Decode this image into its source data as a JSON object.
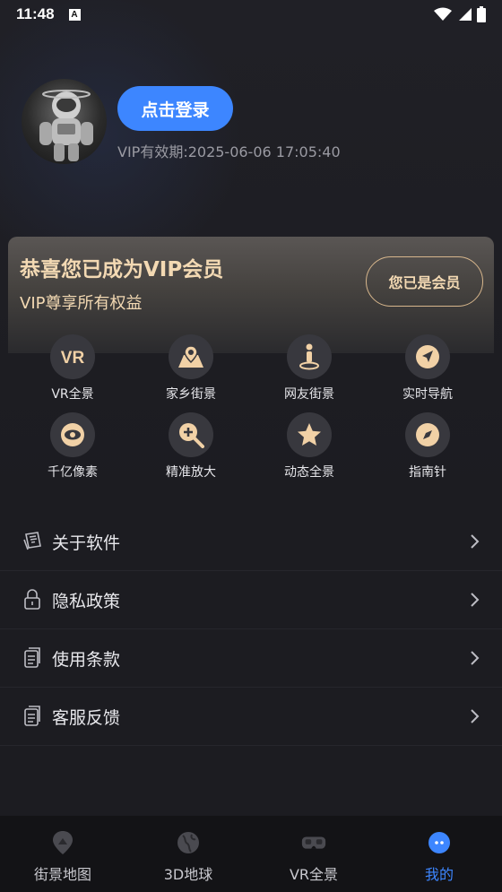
{
  "status_bar": {
    "time": "11:48",
    "notification_glyph": "A"
  },
  "profile": {
    "login_label": "点击登录",
    "vip_expiry": "VIP有效期:2025-06-06 17:05:40"
  },
  "vip_card": {
    "title": "恭喜您已成为VIP会员",
    "subtitle": "VIP尊享所有权益",
    "member_button": "您已是会员"
  },
  "features": [
    {
      "label": "VR全景",
      "icon": "vr-icon"
    },
    {
      "label": "家乡街景",
      "icon": "map-pin-icon"
    },
    {
      "label": "网友街景",
      "icon": "person-pin-icon"
    },
    {
      "label": "实时导航",
      "icon": "navigation-icon"
    },
    {
      "label": "千亿像素",
      "icon": "eye-icon"
    },
    {
      "label": "精准放大",
      "icon": "zoom-in-icon"
    },
    {
      "label": "动态全景",
      "icon": "star-icon"
    },
    {
      "label": "指南针",
      "icon": "compass-icon"
    }
  ],
  "menu": [
    {
      "label": "关于软件",
      "icon": "info-document-icon"
    },
    {
      "label": "隐私政策",
      "icon": "lock-icon"
    },
    {
      "label": "使用条款",
      "icon": "document-icon"
    },
    {
      "label": "客服反馈",
      "icon": "document-icon"
    }
  ],
  "bottom_nav": [
    {
      "label": "街景地图",
      "icon": "street-map-icon",
      "active": false
    },
    {
      "label": "3D地球",
      "icon": "globe-icon",
      "active": false
    },
    {
      "label": "VR全景",
      "icon": "vr-headset-icon",
      "active": false
    },
    {
      "label": "我的",
      "icon": "profile-chat-icon",
      "active": true
    }
  ],
  "colors": {
    "accent_blue": "#3d86ff",
    "gold_text": "#f3d9b3",
    "feature_icon_gold": "#f1d1a6",
    "background": "#1c1c21"
  }
}
